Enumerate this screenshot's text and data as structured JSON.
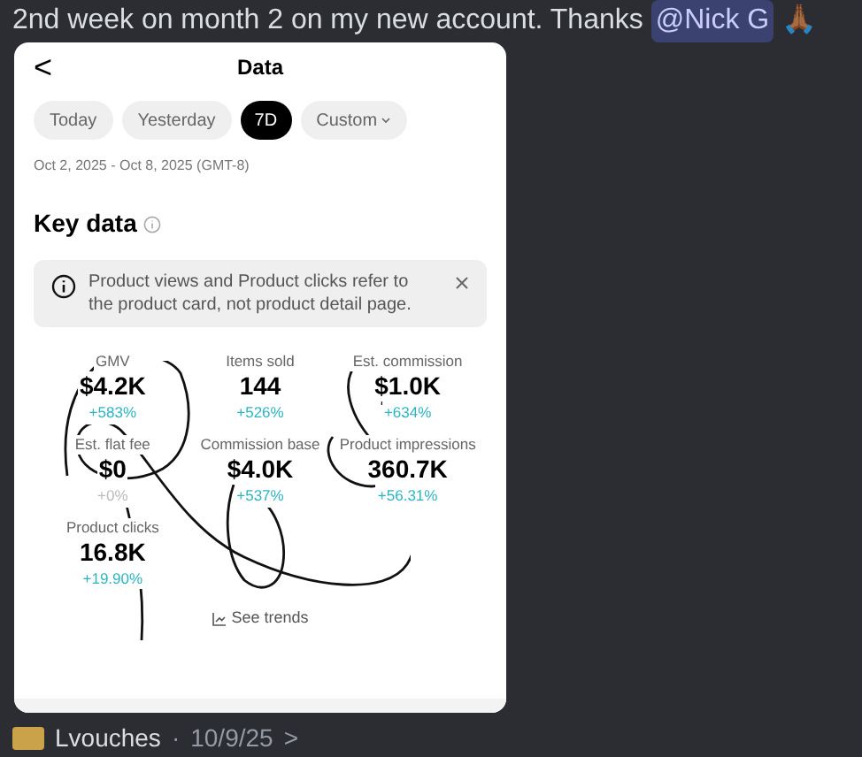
{
  "message": {
    "text": "2nd week on month 2 on my new account. Thanks",
    "mention": "@Nick G",
    "emoji": "🙏🏾"
  },
  "screenshot": {
    "title": "Data",
    "back": "<",
    "tabs": [
      {
        "label": "Today",
        "selected": false
      },
      {
        "label": "Yesterday",
        "selected": false
      },
      {
        "label": "7D",
        "selected": true
      },
      {
        "label": "Custom",
        "selected": false
      }
    ],
    "date_range": "Oct 2, 2025 - Oct 8, 2025 (GMT-8)",
    "section_title": "Key data",
    "notice": "Product views and Product clicks refer to the product card, not product detail page.",
    "metrics": [
      {
        "label": "GMV",
        "value": "$4.2K",
        "change": "+583%",
        "positive": true
      },
      {
        "label": "Items sold",
        "value": "144",
        "change": "+526%",
        "positive": true
      },
      {
        "label": "Est. commission",
        "value": "$1.0K",
        "change": "+634%",
        "positive": true
      },
      {
        "label": "Est. flat fee",
        "value": "$0",
        "change": "+0%",
        "positive": false
      },
      {
        "label": "Commission base",
        "value": "$4.0K",
        "change": "+537%",
        "positive": true
      },
      {
        "label": "Product impressions",
        "value": "360.7K",
        "change": "+56.31%",
        "positive": true
      },
      {
        "label": "Product clicks",
        "value": "16.8K",
        "change": "+19.90%",
        "positive": true
      }
    ],
    "see_trends": "See trends"
  },
  "next_message": {
    "author": "Lvouches",
    "separator": "·",
    "date": "10/9/25",
    "arrow": ">"
  }
}
